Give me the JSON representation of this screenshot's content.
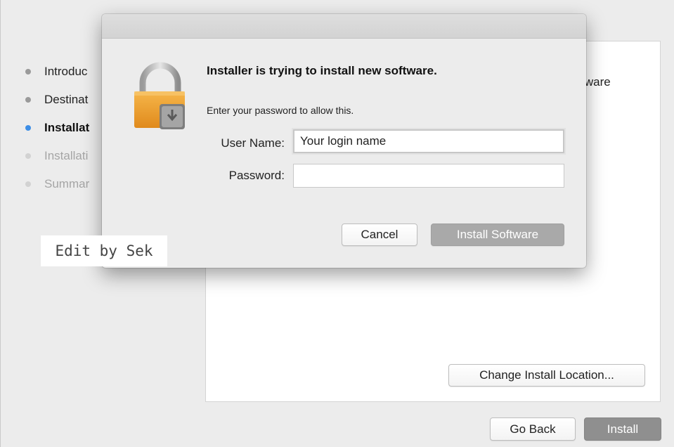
{
  "sidebar": {
    "steps": [
      {
        "label": "Introduc",
        "state": "done"
      },
      {
        "label": "Destinat",
        "state": "done"
      },
      {
        "label": "Installat",
        "state": "current"
      },
      {
        "label": "Installati",
        "state": "future"
      },
      {
        "label": "Summar",
        "state": "future"
      }
    ]
  },
  "content": {
    "partial_text": "oftware",
    "change_location_label": "Change Install Location..."
  },
  "footer": {
    "go_back_label": "Go Back",
    "install_label": "Install"
  },
  "dialog": {
    "title": "Installer is trying to install new software.",
    "message": "Enter your password to allow this.",
    "username_label": "User Name:",
    "username_value": "Your login name",
    "password_label": "Password:",
    "password_value": "",
    "cancel_label": "Cancel",
    "install_software_label": "Install Software",
    "icon": "lock-icon"
  },
  "watermark": "Edit by Sek",
  "colors": {
    "current_step_dot": "#3d8ee6",
    "disabled_button": "#a9a9a9",
    "install_button": "#8f8f8f"
  }
}
